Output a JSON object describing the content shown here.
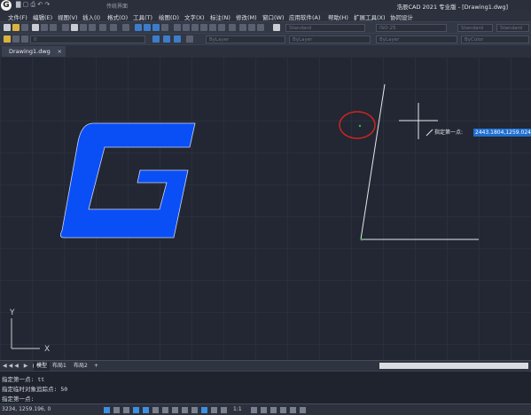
{
  "app": {
    "logo_letter": "G",
    "window_title": "浩辰CAD 2021 专业版 - [Drawing1.dwg]",
    "workspace": "传统界面",
    "quick_access_glyphs": "▇ ▢ ⎙ ↶ ↷"
  },
  "menu": {
    "items": [
      "文件(F)",
      "编辑(E)",
      "视图(V)",
      "插入(I)",
      "格式(O)",
      "工具(T)",
      "绘图(D)",
      "文字(X)",
      "标注(N)",
      "修改(M)",
      "窗口(W)",
      "应用软件(A)",
      "帮助(H)",
      "扩展工具(X)",
      "协同设计"
    ]
  },
  "toolbar1": {
    "text_style": "Standard",
    "dim_style": "ISO-25",
    "table_style": "Standard",
    "mleader_style": "Standard"
  },
  "toolbar2": {
    "layer": "0",
    "color": "ByLayer",
    "linetype": "ByLayer",
    "lineweight": "ByLayer",
    "plotstyle": "ByColor"
  },
  "tabs": {
    "drawing_tab": "Drawing1.dwg",
    "close_glyph": "×"
  },
  "canvas": {
    "tooltip_label": "指定第一点:",
    "tooltip_value": "2443.1804,1259.024",
    "ucs_x": "X",
    "ucs_y": "Y",
    "colors": {
      "background": "#222733",
      "logo_fill": "#0a4ef5",
      "annotation_circle": "#d0241f",
      "line_color": "#e6e8ec",
      "line_endpoint": "#3fb24a"
    }
  },
  "layout": {
    "nav_glyphs": "◀◀◀ ▶ ▶▶",
    "model_tab": "模型",
    "layout1_tab": "布局1",
    "layout2_tab": "布局2",
    "add_glyph": "+"
  },
  "command": {
    "line1": "指定第一点: tt",
    "line2": "指定临时对象追踪点: 50",
    "line3": "指定第一点:"
  },
  "status": {
    "coords": "3234, 1259.196, 0",
    "scale": "1:1"
  }
}
